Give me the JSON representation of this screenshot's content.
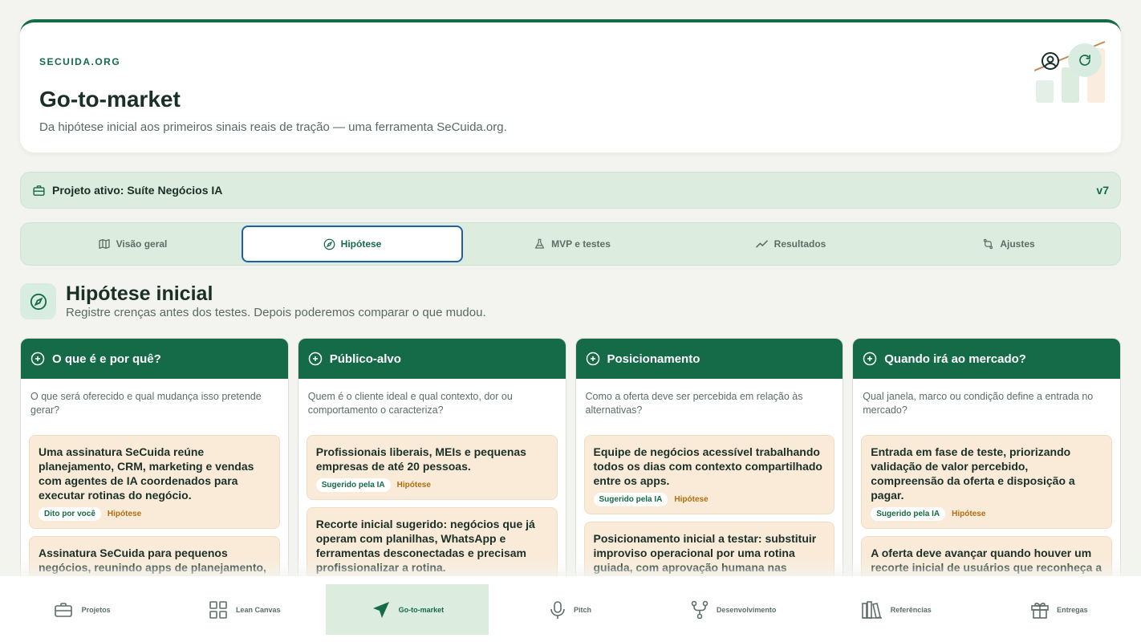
{
  "header": {
    "brand": "SECUIDA.ORG",
    "title": "Go-to-market",
    "subtitle": "Da hipótese inicial aos primeiros sinais reais de tração — uma ferramenta SeCuida.org.",
    "icons": [
      "user-circle-icon",
      "refresh-icon"
    ]
  },
  "project": {
    "label": "Projeto ativo: Suíte Negócios IA",
    "version": "v7",
    "icon": "briefcase-icon"
  },
  "tabs": [
    {
      "label": "Visão geral",
      "icon": "map-icon"
    },
    {
      "label": "Hipótese",
      "icon": "compass-icon",
      "active": true
    },
    {
      "label": "MVP e testes",
      "icon": "flask-icon"
    },
    {
      "label": "Resultados",
      "icon": "trend-icon"
    },
    {
      "label": "Ajustes",
      "icon": "swap-icon"
    }
  ],
  "section": {
    "title": "Hipótese inicial",
    "subtitle": "Registre crenças antes dos testes. Depois poderemos comparar o que mudou.",
    "icon": "compass-icon"
  },
  "columns": [
    {
      "title": "O que é e por quê?",
      "question": "O que será oferecido e qual mudança isso pretende gerar?",
      "cards": [
        {
          "text": "Uma assinatura SeCuida reúne planejamento, CRM, marketing e vendas com agentes de IA coordenados para executar rotinas do negócio.",
          "source": "Dito por você",
          "type": "Hipótese"
        },
        {
          "text": "Assinatura SeCuida para pequenos negócios, reunindo apps de planejamento,",
          "source": "",
          "type": ""
        }
      ]
    },
    {
      "title": "Público-alvo",
      "question": "Quem é o cliente ideal e qual contexto, dor ou comportamento o caracteriza?",
      "cards": [
        {
          "text": "Profissionais liberais, MEIs e pequenas empresas de até 20 pessoas.",
          "source": "Sugerido pela IA",
          "type": "Hipótese"
        },
        {
          "text": "Recorte inicial sugerido: negócios que já operam com planilhas, WhatsApp e ferramentas desconectadas e precisam profissionalizar a rotina.",
          "source": "",
          "type": ""
        }
      ]
    },
    {
      "title": "Posicionamento",
      "question": "Como a oferta deve ser percebida em relação às alternativas?",
      "cards": [
        {
          "text": "Equipe de negócios acessível trabalhando todos os dias com contexto compartilhado entre os apps.",
          "source": "Sugerido pela IA",
          "type": "Hipótese"
        },
        {
          "text": "Posicionamento inicial a testar: substituir improviso operacional por uma rotina guiada, com aprovação humana nas decisões",
          "source": "",
          "type": ""
        }
      ]
    },
    {
      "title": "Quando irá ao mercado?",
      "question": "Qual janela, marco ou condição define a entrada no mercado?",
      "cards": [
        {
          "text": "Entrada em fase de teste, priorizando validação de valor percebido, compreensão da oferta e disposição a pagar.",
          "source": "Sugerido pela IA",
          "type": "Hipótese"
        },
        {
          "text": "A oferta deve avançar quando houver um recorte inicial de usuários que reconheça a dor e aceite testar uma jornada curta.",
          "source": "",
          "type": ""
        }
      ]
    }
  ],
  "bottom_nav": [
    {
      "label": "Projetos",
      "icon": "briefcase-icon"
    },
    {
      "label": "Lean Canvas",
      "icon": "grid-icon"
    },
    {
      "label": "Go-to-market",
      "icon": "send-icon",
      "active": true
    },
    {
      "label": "Pitch",
      "icon": "microphone-icon"
    },
    {
      "label": "Desenvolvimento",
      "icon": "branch-icon"
    },
    {
      "label": "Referências",
      "icon": "library-icon"
    },
    {
      "label": "Entregas",
      "icon": "gift-icon"
    }
  ],
  "colors": {
    "primary": "#156b48",
    "card": "#faebd9",
    "tint": "#dcecdf",
    "focus": "#1e5fa8",
    "hypothesis": "#b06d10"
  }
}
